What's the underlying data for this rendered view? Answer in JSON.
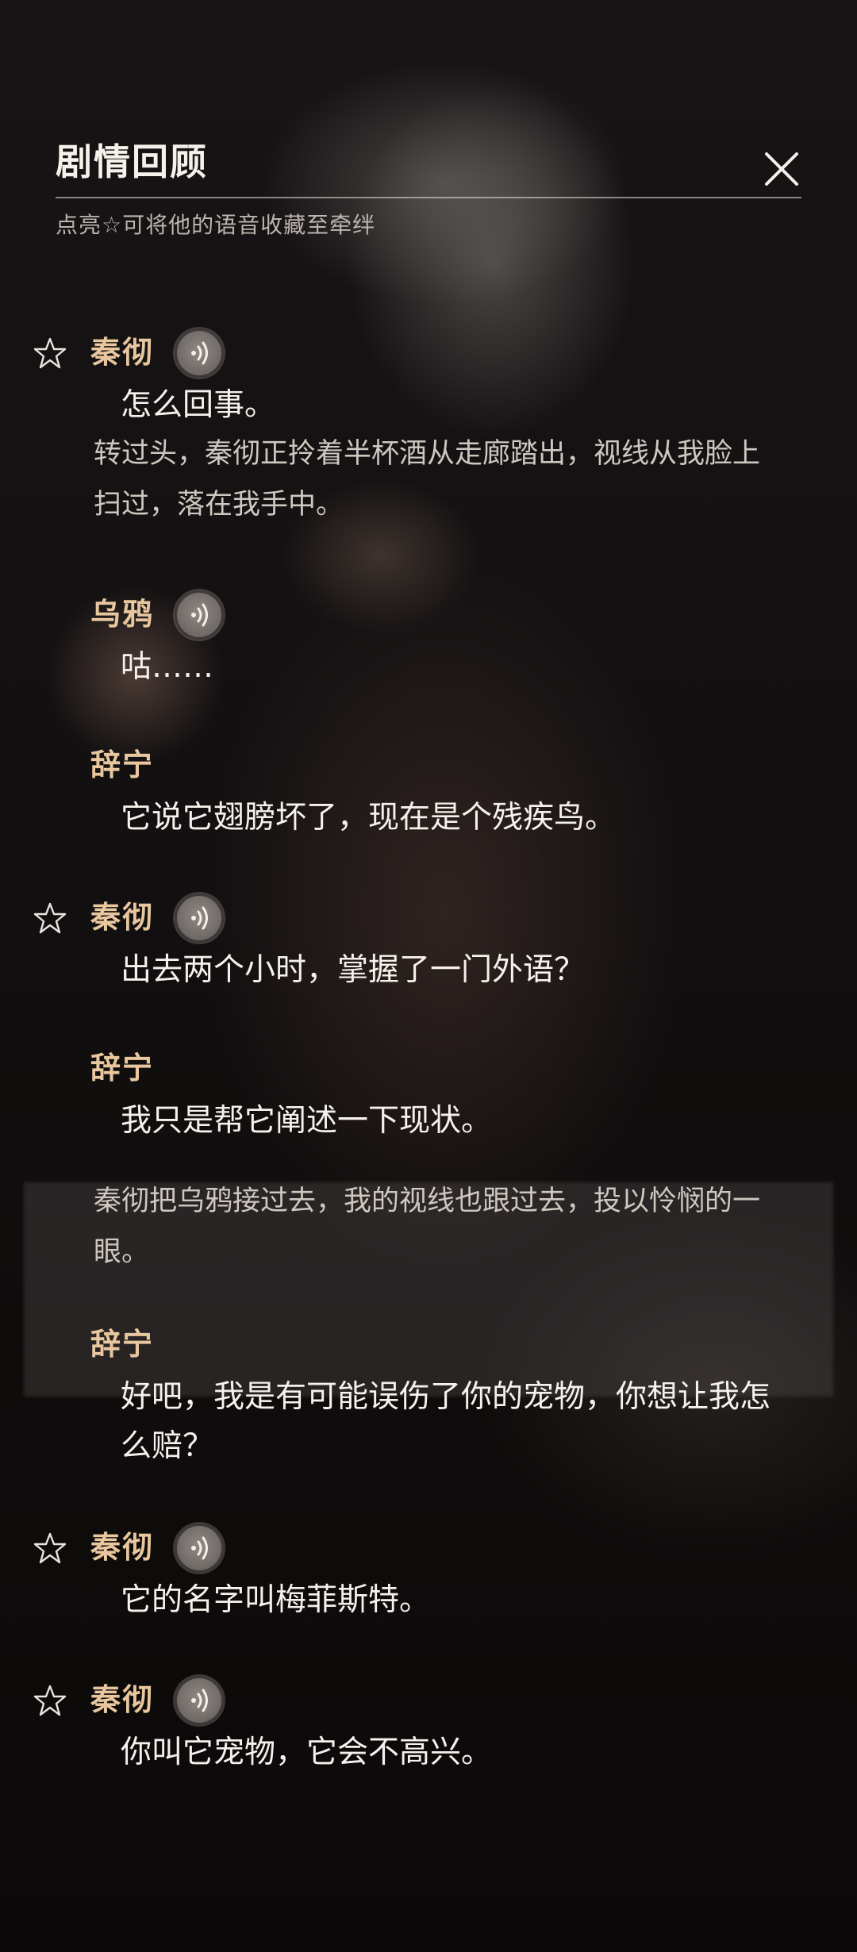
{
  "header": {
    "title": "剧情回顾",
    "subtitle": "点亮☆可将他的语音收藏至牵绊"
  },
  "icons": {
    "close": "close-icon",
    "star": "star-outline-icon",
    "voice": "voice-play-icon"
  },
  "colors": {
    "speaker_name": "#e8c79e",
    "dialogue": "#f5f1ec",
    "narration": "#cfc8c1"
  },
  "entries": [
    {
      "speaker": "秦彻",
      "text": "怎么回事。"
    },
    {
      "narration": "转过头，秦彻正拎着半杯酒从走廊踏出，视线从我脸上扫过，落在我手中。"
    },
    {
      "speaker": "乌鸦",
      "text": "咕……"
    },
    {
      "speaker": "辞宁",
      "text": "它说它翅膀坏了，现在是个残疾鸟。"
    },
    {
      "speaker": "秦彻",
      "text": "出去两个小时，掌握了一门外语？"
    },
    {
      "speaker": "辞宁",
      "text": "我只是帮它阐述一下现状。"
    },
    {
      "narration": "秦彻把乌鸦接过去，我的视线也跟过去，投以怜悯的一眼。"
    },
    {
      "speaker": "辞宁",
      "text": "好吧，我是有可能误伤了你的宠物，你想让我怎么赔？"
    },
    {
      "speaker": "秦彻",
      "text": "它的名字叫梅菲斯特。"
    },
    {
      "speaker": "秦彻",
      "text": "你叫它宠物，它会不高兴。"
    }
  ]
}
